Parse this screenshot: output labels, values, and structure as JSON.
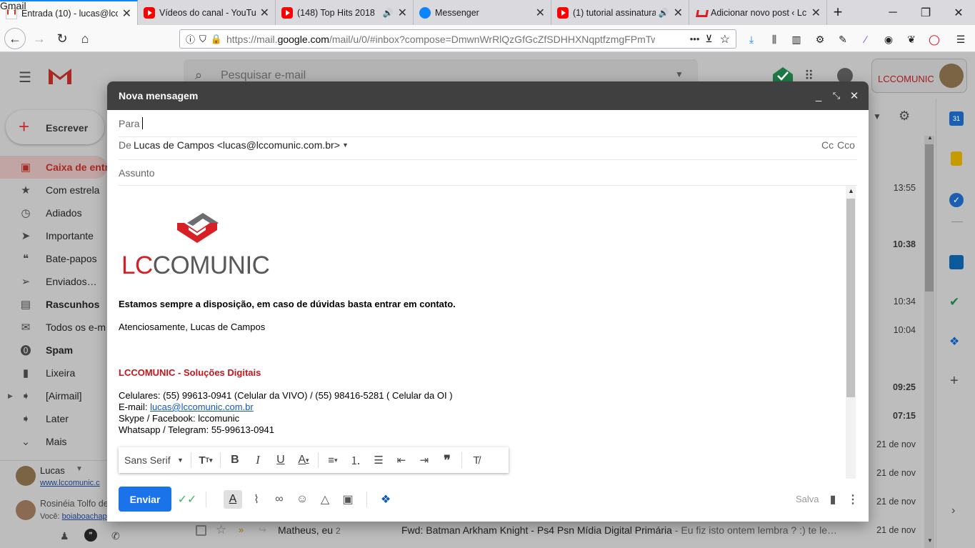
{
  "browser": {
    "tabs": [
      {
        "label": "Entrada (10) - lucas@lcc",
        "icon": "gmail-icon",
        "badge": "10",
        "active": true
      },
      {
        "label": "Vídeos do canal - YouTu",
        "icon": "youtube-icon"
      },
      {
        "label": "(148) Top Hits 2018",
        "icon": "youtube-icon"
      },
      {
        "label": "Messenger",
        "icon": "messenger-icon"
      },
      {
        "label": "(1) tutorial assinatura",
        "icon": "youtube-icon"
      },
      {
        "label": "Adicionar novo post ‹ Lc",
        "icon": "lccomunic-icon"
      }
    ],
    "new_tab": "+",
    "url_base": "https://mail.",
    "url_domain": "google.com",
    "url_rest": "/mail/u/0/#inbox?compose=DmwnWrRlQzGfGcZfSDHHXNqptfzmgFPmTw",
    "url_more": "•••"
  },
  "gmail": {
    "app_name": "Gmail",
    "search_placeholder": "Pesquisar e-mail",
    "compose_label": "Escrever",
    "brand_text": "LCCOMUNIC",
    "sidebar": [
      {
        "label": "Caixa de entr",
        "icon": "inbox-icon",
        "bold": true,
        "active": true
      },
      {
        "label": "Com estrela",
        "icon": "star-icon"
      },
      {
        "label": "Adiados",
        "icon": "clock-icon"
      },
      {
        "label": "Importante",
        "icon": "important-icon"
      },
      {
        "label": "Bate-papos",
        "icon": "chat-icon"
      },
      {
        "label": "Enviados…",
        "icon": "send-icon"
      },
      {
        "label": "Rascunhos",
        "icon": "draft-icon",
        "bold": true
      },
      {
        "label": "Todos os e-m",
        "icon": "mail-icon"
      },
      {
        "label": "Spam",
        "icon": "spam-icon",
        "bold": true
      },
      {
        "label": "Lixeira",
        "icon": "trash-icon"
      },
      {
        "label": "[Airmail]",
        "icon": "label-icon"
      },
      {
        "label": "Later",
        "icon": "label-icon"
      },
      {
        "label": "Mais",
        "icon": "chevron-down-icon"
      }
    ],
    "hangouts": {
      "user_name": "Lucas",
      "user_link": "www.lccomunic.c",
      "contact_name": "Rosinéia Tolfo de",
      "contact_sub_prefix": "Você: ",
      "contact_sub_link": "boiaboachap"
    },
    "mail_times": [
      "13:55",
      "10:38",
      "10:34",
      "10:04",
      "09:25",
      "07:15",
      "21 de nov",
      "21 de nov",
      "21 de nov",
      "21 de nov",
      "21 de nov"
    ],
    "last_row": {
      "sender": "Matheus, eu",
      "count": "2",
      "subject": "Fwd: Batman Arkham Knight - Ps4 Psn Mídia Digital Primária",
      "snippet": " - Eu fiz isto ontem lembra ? :) te le…",
      "time": "21 de nov"
    }
  },
  "compose": {
    "title": "Nova mensagem",
    "to_label": "Para",
    "from_label": "De",
    "from_value": "Lucas de Campos <lucas@lccomunic.com.br>",
    "cc_label": "Cc",
    "bcc_label": "Cco",
    "subject_placeholder": "Assunto",
    "logo_lc": "LC",
    "logo_rest": "COMUNIC",
    "line1": "Estamos sempre a disposição, em caso de dúvidas basta entrar em contato.",
    "line2": "Atenciosamente, Lucas de Campos",
    "company": "LCCOMUNIC - Soluções Digitais",
    "phones": "Celulares: (55) 99613-0941 (Celular da VIVO)  / (55) 98416-5281 ( Celular da OI )",
    "email_label": "E-mail: ",
    "email_link": "lucas@lccomunic.com.br",
    "skype": "Skype / Facebook: lccomunic",
    "whatsapp": "Whatsapp / Telegram: 55-99613-0941",
    "font_select": "Sans Serif",
    "send_label": "Enviar",
    "saved_label": "Salva"
  },
  "colors": {
    "brand_red": "#d71f26",
    "gmail_blue": "#1a73e8",
    "compose_header": "#404040"
  }
}
